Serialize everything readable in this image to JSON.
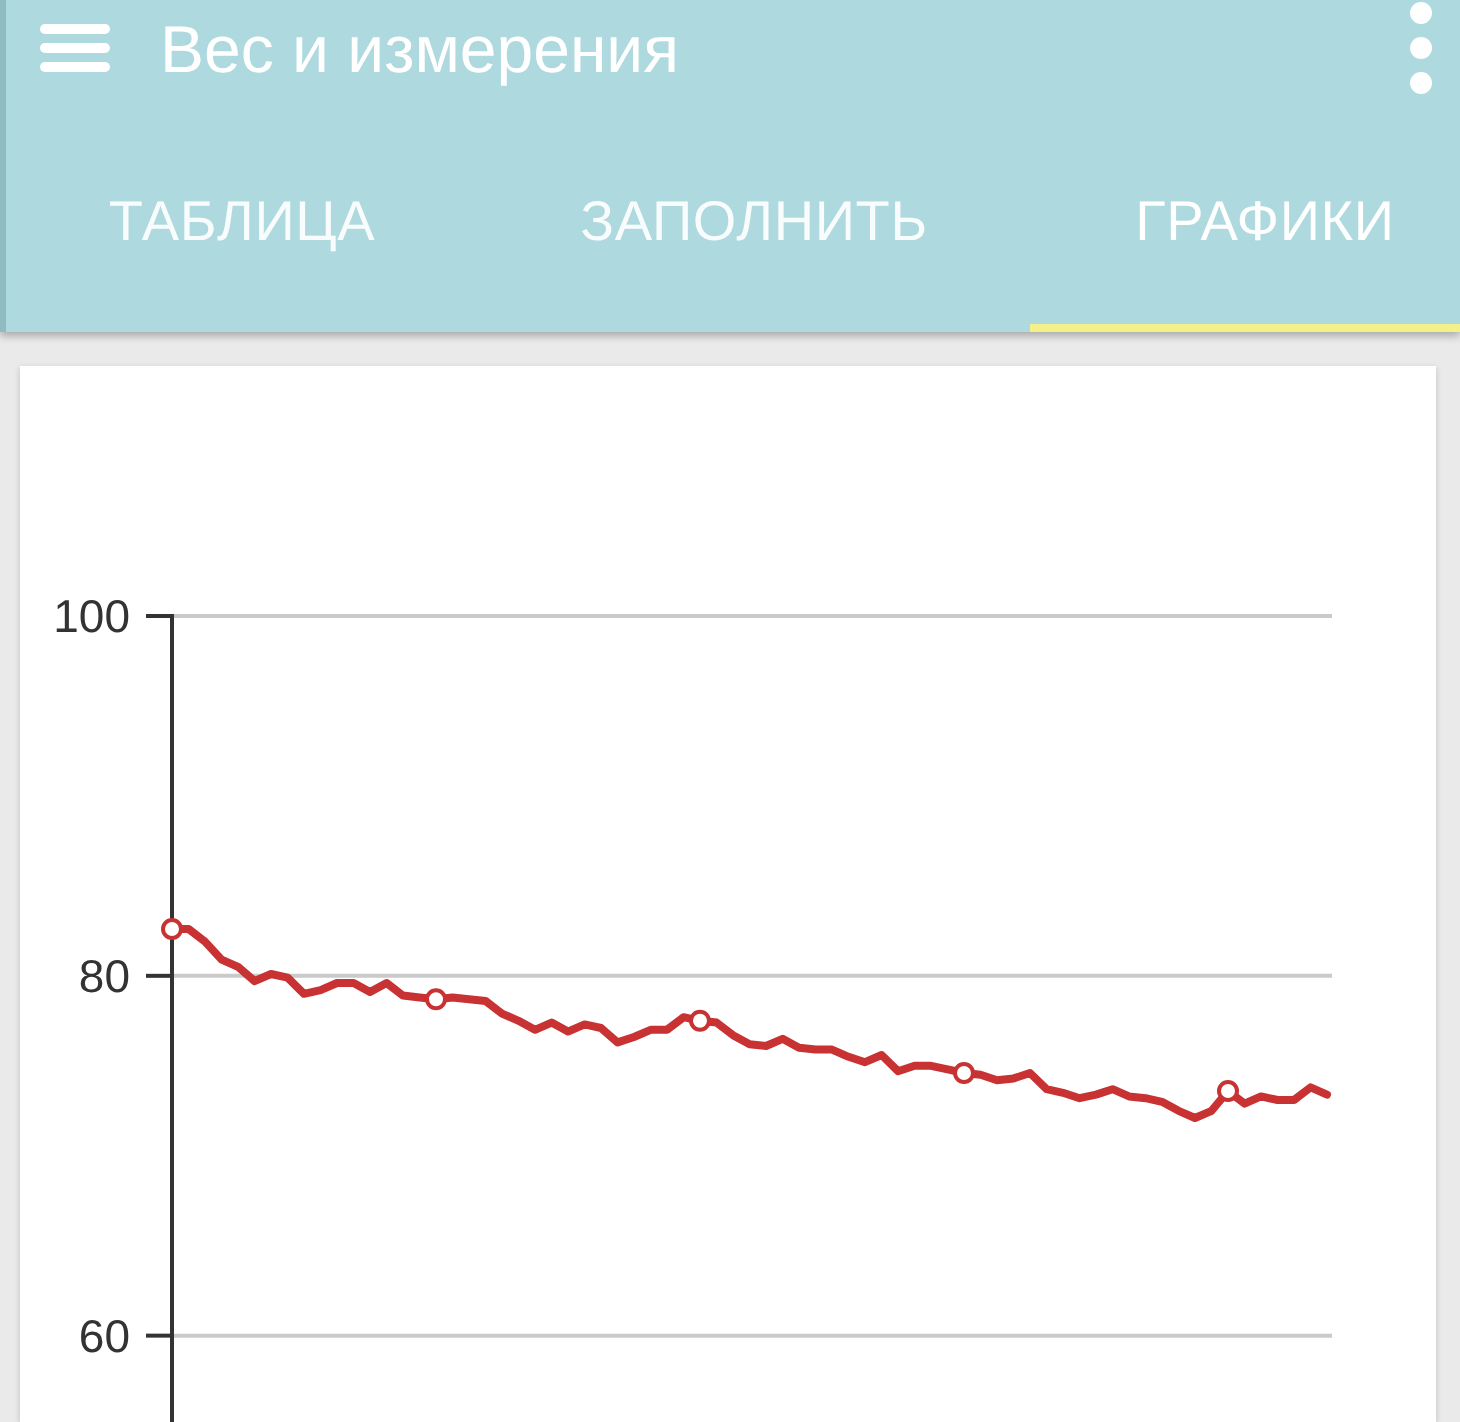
{
  "app_bar": {
    "title": "Вес и измерения"
  },
  "tabs": [
    {
      "label": "ТАБЛИЦА",
      "selected": false
    },
    {
      "label": "ЗАПОЛНИТЬ",
      "selected": false
    },
    {
      "label": "ГРАФИКИ",
      "selected": true
    }
  ],
  "chart": {
    "chart_data": {
      "type": "line",
      "ylim": [
        55.2,
        100
      ],
      "yticks": [
        60,
        80,
        100
      ],
      "series": [
        {
          "color": "#c83232",
          "values": [
            82.6,
            82.6,
            81.9,
            80.9,
            80.5,
            79.7,
            80.1,
            79.9,
            79.0,
            79.2,
            79.6,
            79.6,
            79.1,
            79.6,
            78.9,
            78.8,
            78.7,
            78.8,
            78.7,
            78.6,
            77.9,
            77.5,
            77.0,
            77.4,
            76.9,
            77.3,
            77.1,
            76.3,
            76.6,
            77.0,
            77.0,
            77.7,
            77.5,
            77.4,
            76.7,
            76.2,
            76.1,
            76.5,
            76.0,
            75.9,
            75.9,
            75.5,
            75.2,
            75.6,
            74.7,
            75.0,
            75.0,
            74.8,
            74.6,
            74.5,
            74.2,
            74.3,
            74.6,
            73.7,
            73.5,
            73.2,
            73.4,
            73.7,
            73.3,
            73.2,
            73.0,
            72.5,
            72.1,
            72.5,
            73.6,
            72.9,
            73.3,
            73.1,
            73.1,
            73.8,
            73.4
          ]
        }
      ]
    }
  }
}
